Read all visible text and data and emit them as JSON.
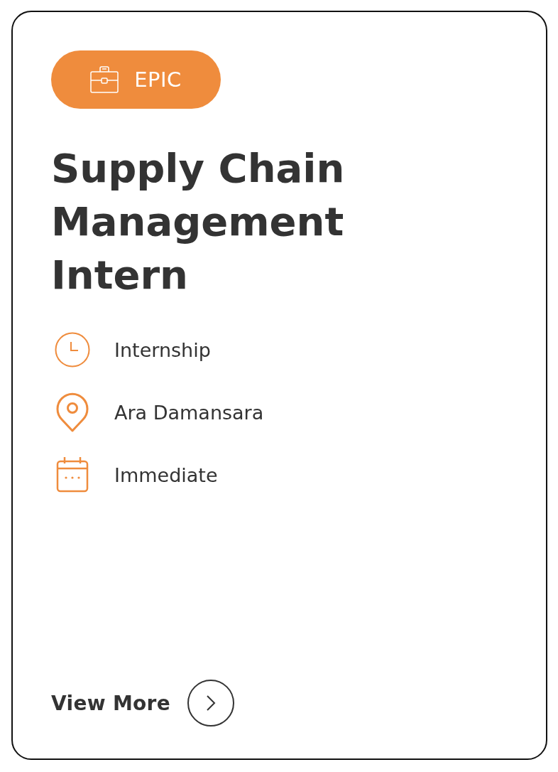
{
  "badge": {
    "label": "EPIC"
  },
  "title": "Supply Chain Management Intern",
  "details": [
    {
      "kind": "clock",
      "text": "Internship"
    },
    {
      "kind": "pin",
      "text": "Ara Damansara"
    },
    {
      "kind": "calendar",
      "text": "Immediate"
    }
  ],
  "link": {
    "label": "View More"
  }
}
